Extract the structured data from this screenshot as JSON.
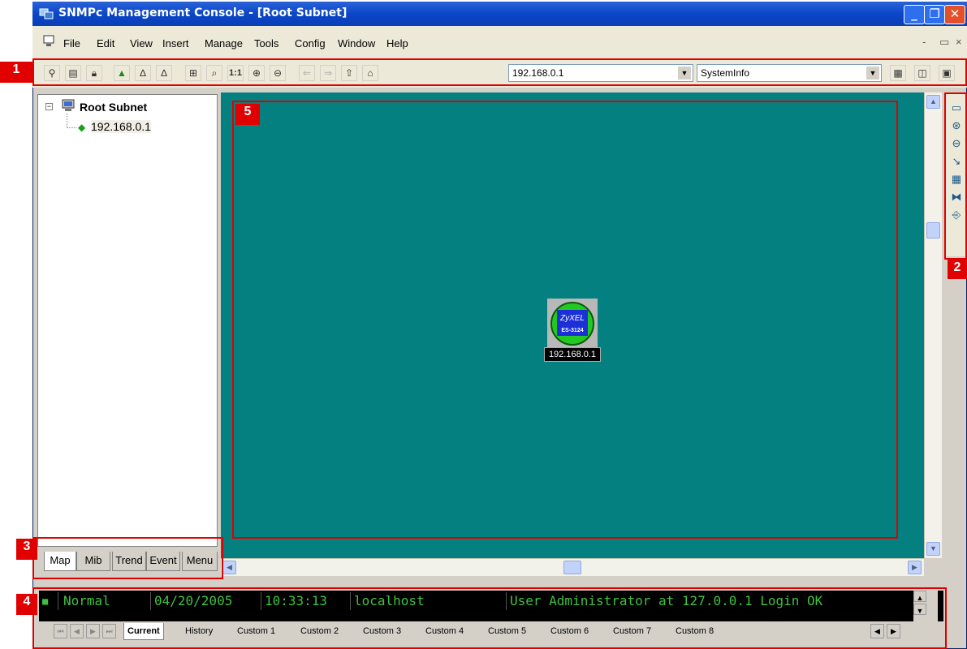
{
  "window": {
    "title": "SNMPc Management Console - [Root Subnet]",
    "controls": {
      "minimize": "_",
      "maximize": "❐",
      "close": "✕"
    }
  },
  "menu": {
    "items": [
      "File",
      "Edit",
      "View",
      "Insert",
      "Manage",
      "Tools",
      "Config",
      "Window",
      "Help"
    ],
    "mdi_controls": [
      "-",
      "▭",
      "×"
    ]
  },
  "toolbar": {
    "address_value": "192.168.0.1",
    "menu_value": "SystemInfo",
    "zoom_label": "1:1"
  },
  "tree": {
    "root": "Root Subnet",
    "child": "192.168.0.1",
    "expander": "−"
  },
  "left_tabs": [
    "Map",
    "Mib",
    "Trend",
    "Event",
    "Menu"
  ],
  "map": {
    "device_brand": "ZyXEL",
    "device_model": "ES-3124",
    "device_label": "192.168.0.1"
  },
  "event_log": {
    "severity": "Normal",
    "date": "04/20/2005",
    "time": "10:33:13",
    "source": "localhost",
    "message": "User Administrator at 127.0.0.1 Login OK"
  },
  "event_tabs": [
    "Current",
    "History",
    "Custom 1",
    "Custom 2",
    "Custom 3",
    "Custom 4",
    "Custom 5",
    "Custom 6",
    "Custom 7",
    "Custom 8"
  ],
  "callouts": [
    "1",
    "2",
    "3",
    "4",
    "5"
  ],
  "colors": {
    "map_background": "#058080",
    "callout": "#e00000",
    "event_text": "#3ec23e",
    "titlebar": "#0b46c8"
  }
}
